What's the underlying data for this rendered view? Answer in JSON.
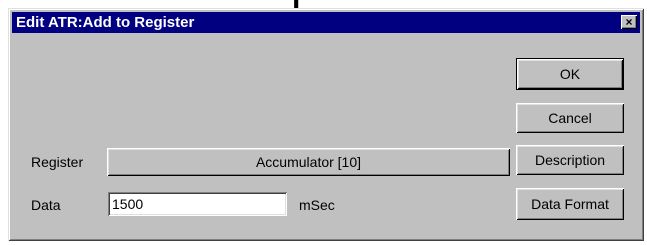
{
  "window": {
    "title": "Edit ATR:Add to Register",
    "close_glyph": "×"
  },
  "buttons": {
    "ok": "OK",
    "cancel": "Cancel",
    "description": "Description",
    "data_format": "Data Format"
  },
  "register": {
    "label": "Register",
    "value": "Accumulator [10]"
  },
  "data_field": {
    "label": "Data",
    "value": "1500",
    "unit": "mSec"
  },
  "colors": {
    "titlebar": "#000080",
    "face": "#c0c0c0"
  }
}
